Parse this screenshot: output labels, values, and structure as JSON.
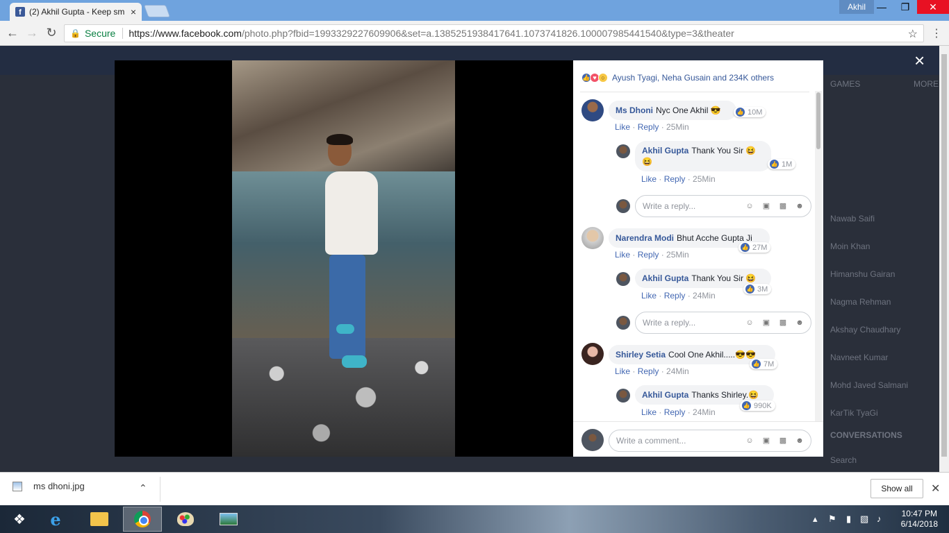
{
  "browser": {
    "tab_title": "(2) Akhil Gupta - Keep sm",
    "tab_favicon": "f",
    "tab_close": "×",
    "profile_name": "Akhil",
    "minimize": "—",
    "restore": "❐",
    "close": "✕",
    "back": "←",
    "forward": "→",
    "reload": "↻",
    "secure_label": "Secure",
    "url_host": "https://www.facebook.com",
    "url_rest": "/photo.php?fbid=1993329227609906&set=a.1385251938417641.1073741826.100007985441540&type=3&theater",
    "bookmark_star": "☆",
    "menu": "⋮"
  },
  "theater": {
    "close": "×"
  },
  "panel": {
    "reactions_text": "Ayush Tyagi, Neha Gusain and 234K others",
    "comments": [
      {
        "name": "Ms Dhoni",
        "text": "Nyc One Akhil 😎",
        "likes": "10M",
        "like_label": "Like",
        "reply_label": "Reply",
        "time": "25Min",
        "reply": {
          "name": "Akhil Gupta",
          "text": "Thank You Sir 😆😆",
          "likes": "1M",
          "like_label": "Like",
          "reply_label": "Reply",
          "time": "25Min"
        },
        "reply_placeholder": "Write a reply..."
      },
      {
        "name": "Narendra Modi",
        "text": "Bhut Acche Gupta Ji",
        "likes": "27M",
        "like_label": "Like",
        "reply_label": "Reply",
        "time": "25Min",
        "reply": {
          "name": "Akhil Gupta",
          "text": "Thank You Sir 😆",
          "likes": "3M",
          "like_label": "Like",
          "reply_label": "Reply",
          "time": "24Min"
        },
        "reply_placeholder": "Write a reply..."
      },
      {
        "name": "Shirley Setia",
        "text": "Cool One Akhil.....😎😎",
        "likes": "7M",
        "like_label": "Like",
        "reply_label": "Reply",
        "time": "24Min",
        "reply": {
          "name": "Akhil Gupta",
          "text": "Thanks Shirley.😆",
          "likes": "990K",
          "like_label": "Like",
          "reply_label": "Reply",
          "time": "24Min"
        }
      }
    ],
    "comment_placeholder": "Write a comment..."
  },
  "background_sidebar": {
    "games_label": "GAMES",
    "more_label": "MORE",
    "contacts": [
      "Nawab Saifi",
      "Moin Khan",
      "Himanshu Gairan",
      "Nagma Rehman",
      "Akshay Chaudhary",
      "Navneet Kumar",
      "Mohd Javed Salmani",
      "KarTik TyaGi"
    ],
    "conversations_label": "CONVERSATIONS",
    "search_placeholder": "Search"
  },
  "download_bar": {
    "file_name": "ms dhoni.jpg",
    "chevron": "⌃",
    "show_all": "Show all",
    "close": "✕"
  },
  "taskbar": {
    "time": "10:47 PM",
    "date": "6/14/2018"
  },
  "colors": {
    "fb_blue": "#4267b2",
    "link_blue": "#365899",
    "chrome_tab_strip": "#6fa3de",
    "close_red": "#e81123"
  }
}
